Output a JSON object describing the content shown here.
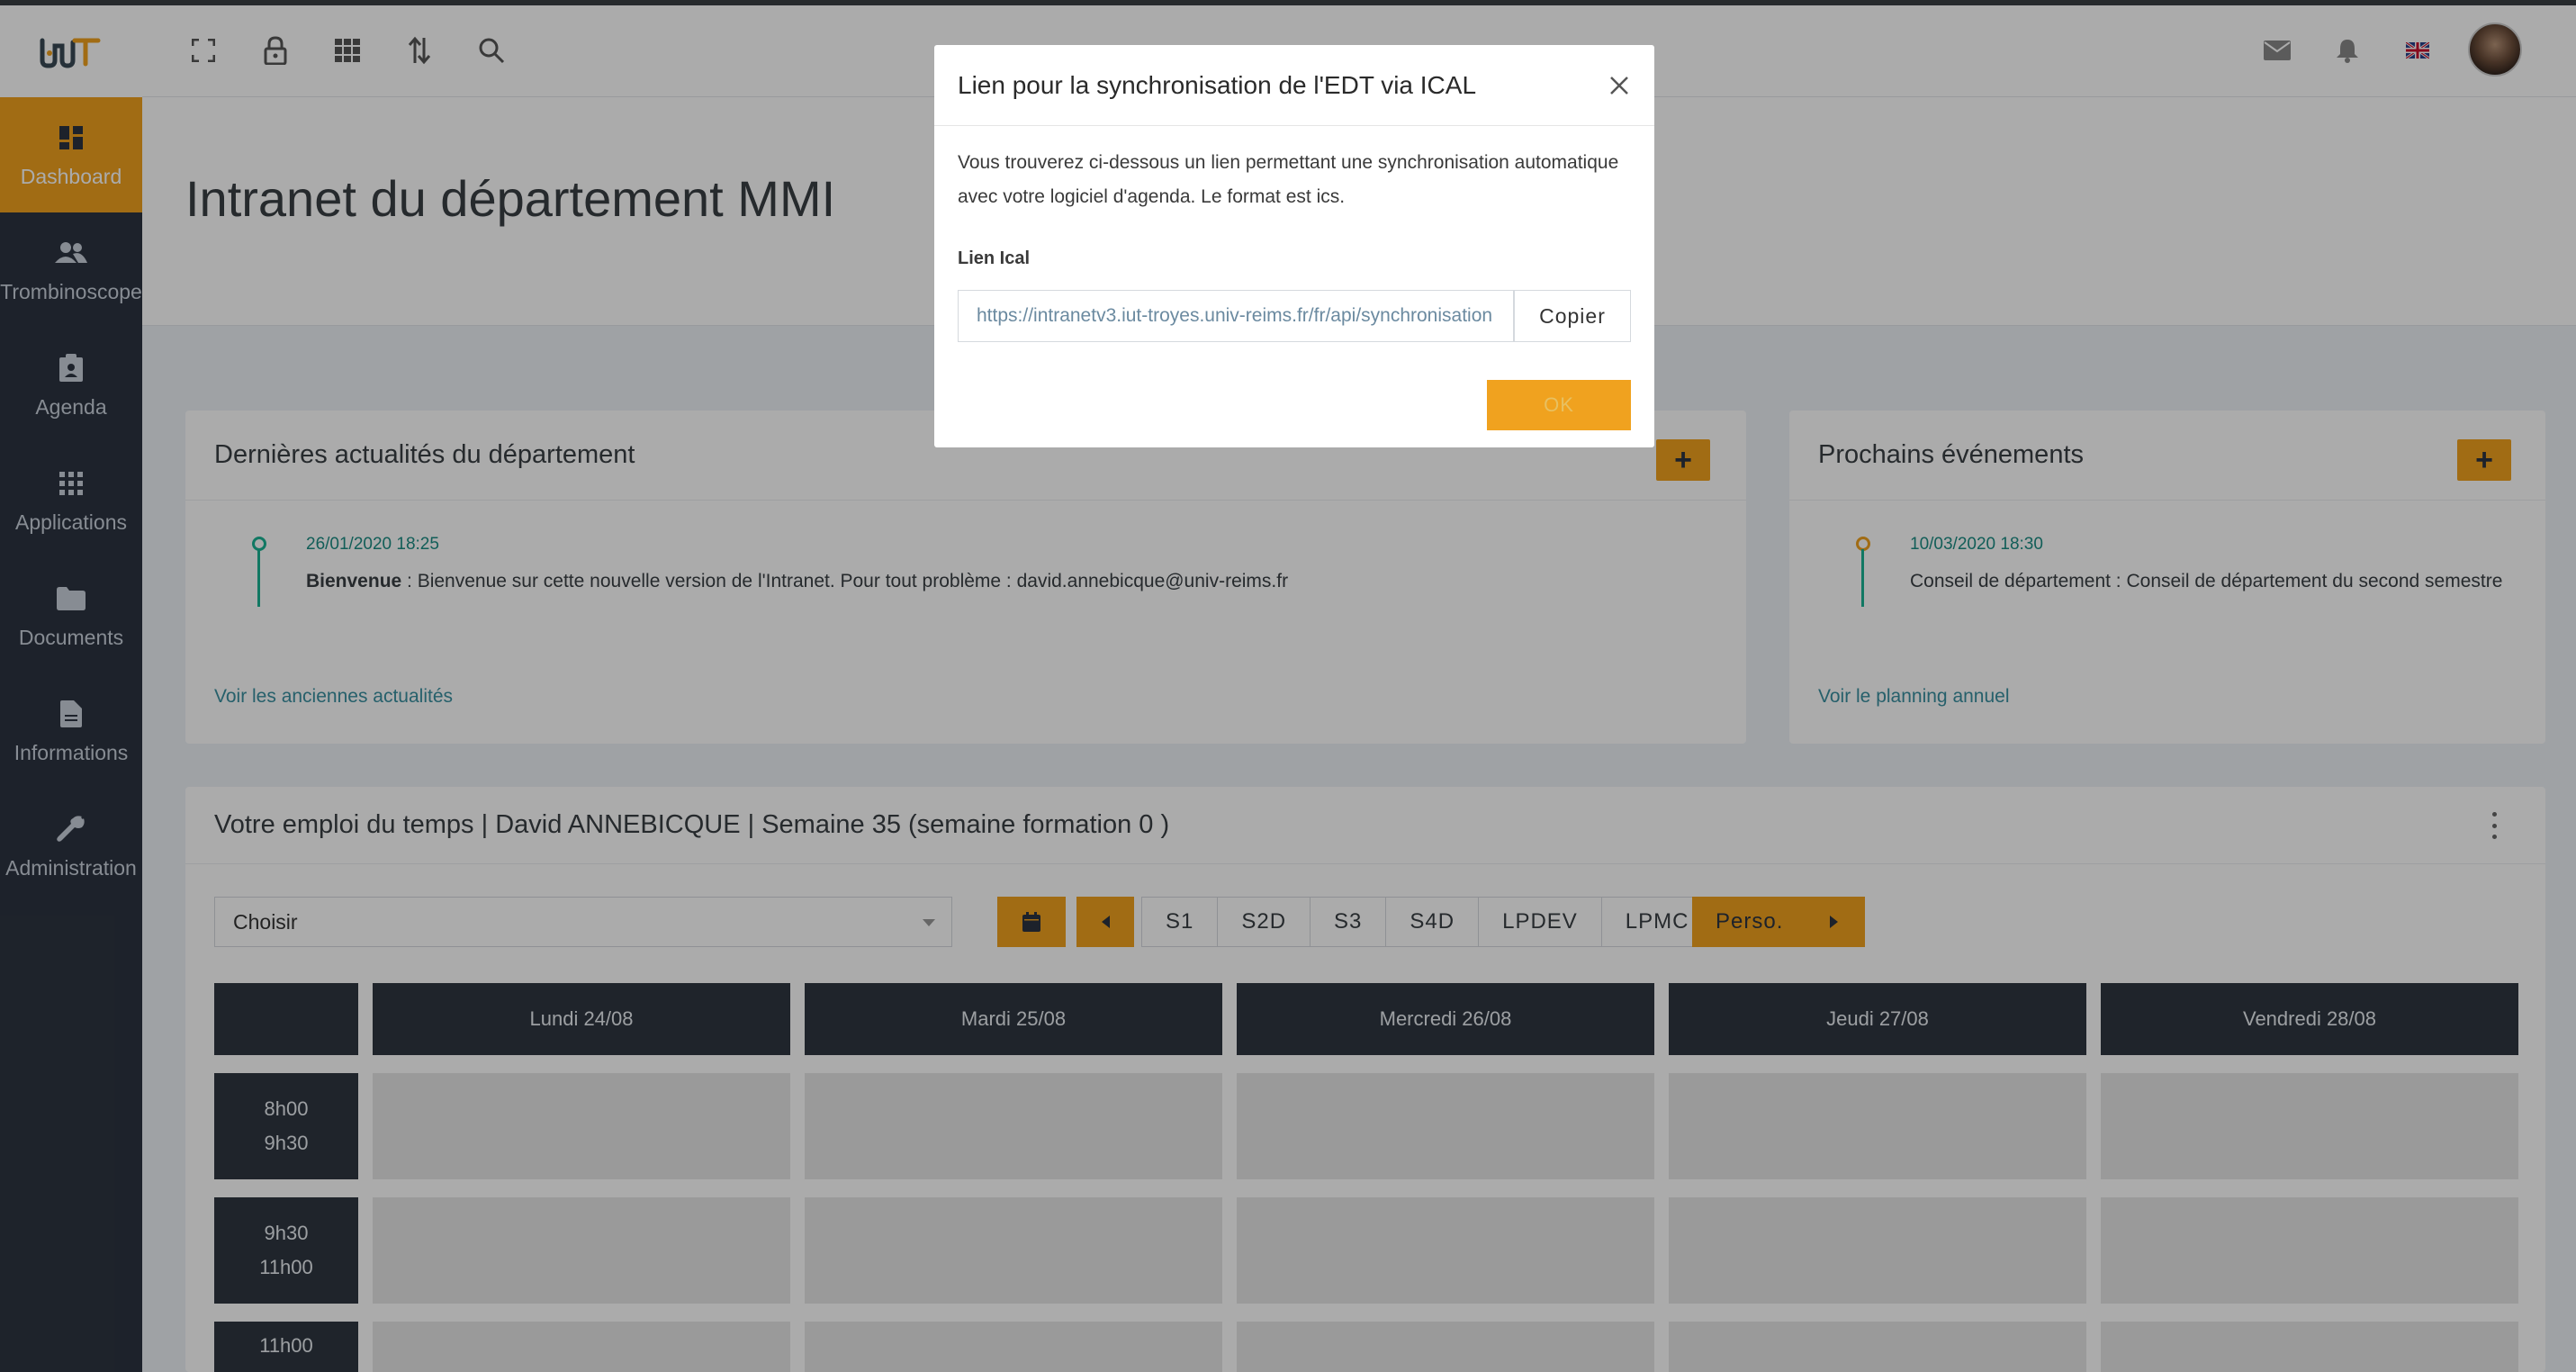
{
  "logo": {
    "text": "IUT"
  },
  "sidebar": {
    "items": [
      {
        "label": "Dashboard",
        "icon": "dashboard-icon",
        "active": true
      },
      {
        "label": "Trombinoscope",
        "icon": "users-icon",
        "active": false
      },
      {
        "label": "Agenda",
        "icon": "agenda-icon",
        "active": false
      },
      {
        "label": "Applications",
        "icon": "apps-grid-icon",
        "active": false
      },
      {
        "label": "Documents",
        "icon": "folder-icon",
        "active": false
      },
      {
        "label": "Informations",
        "icon": "file-icon",
        "active": false
      },
      {
        "label": "Administration",
        "icon": "wrench-icon",
        "active": false
      }
    ]
  },
  "topbar": {
    "icons": [
      "fullscreen-icon",
      "lock-icon",
      "grid-icon",
      "sort-arrows-icon",
      "search-icon"
    ],
    "right_icons": [
      "mail-icon",
      "bell-icon",
      "uk-flag-icon",
      "avatar"
    ]
  },
  "page": {
    "title": "Intranet du département MMI"
  },
  "news": {
    "title": "Dernières actualités du département",
    "items": [
      {
        "date": "26/01/2020 18:25",
        "title": "Bienvenue",
        "text": " : Bienvenue sur cette nouvelle version de l'Intranet. Pour tout problème : david.annebicque@univ-reims.fr"
      }
    ],
    "link": "Voir les anciennes actualités"
  },
  "events": {
    "title": "Prochains événements",
    "items": [
      {
        "date": "10/03/2020 18:30",
        "text": "Conseil de département : Conseil de département du second semestre"
      }
    ],
    "link": "Voir le planning annuel"
  },
  "edt": {
    "title": "Votre emploi du temps | David ANNEBICQUE | Semaine 35 (semaine formation 0 )",
    "select_value": "Choisir",
    "groups": [
      "S1",
      "S2D",
      "S3",
      "S4D",
      "LPDEV",
      "LPMC"
    ],
    "perso": "Perso.",
    "days": [
      "Lundi 24/08",
      "Mardi 25/08",
      "Mercredi 26/08",
      "Jeudi 27/08",
      "Vendredi 28/08"
    ],
    "slots": [
      {
        "start": "8h00",
        "end": "9h30"
      },
      {
        "start": "9h30",
        "end": "11h00"
      },
      {
        "start": "11h00",
        "end": ""
      }
    ]
  },
  "modal": {
    "title": "Lien pour la synchronisation de l'EDT via ICAL",
    "description": "Vous trouverez ci-dessous un lien permettant une synchronisation automatique avec votre logiciel d'agenda. Le format est ics.",
    "label": "Lien Ical",
    "url": "https://intranetv3.iut-troyes.univ-reims.fr/fr/api/synchronisation",
    "copy": "Copier",
    "ok": "OK"
  },
  "colors": {
    "accent": "#f0a21f",
    "sidebar": "#2c3440",
    "teal": "#1ab394"
  }
}
